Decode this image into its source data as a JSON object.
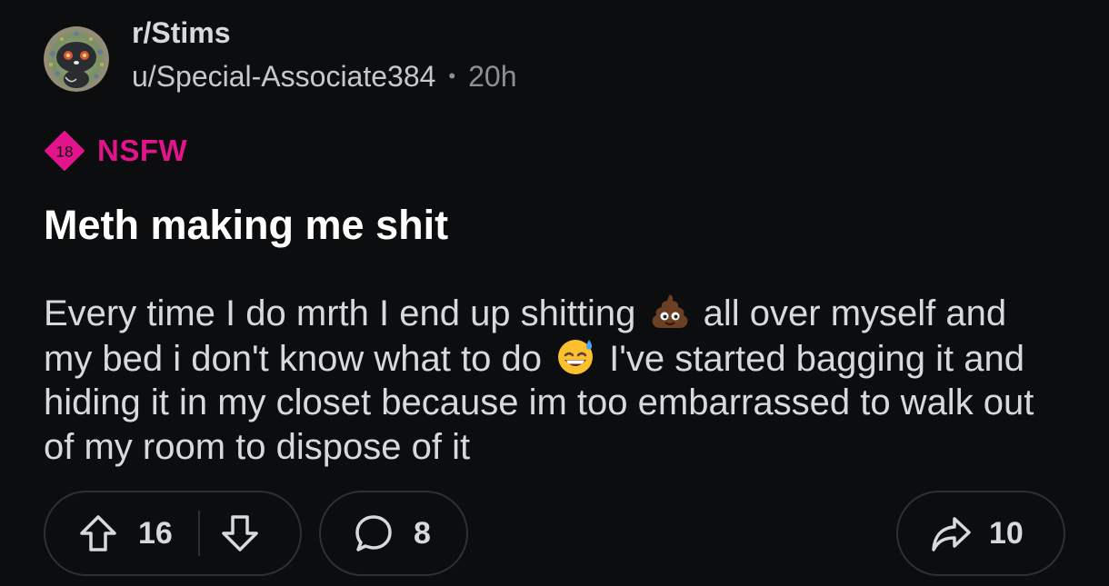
{
  "post": {
    "subreddit": "r/Stims",
    "author": "u/Special-Associate384",
    "separator": "•",
    "age": "20h",
    "nsfw_badge_number": "18",
    "nsfw_label": "NSFW",
    "title": "Meth making me shit",
    "body": {
      "part1": "Every time I do mrth I end up shitting ",
      "emoji1": "poop-emoji",
      "part2": " all over myself and my bed i don't know what to do ",
      "emoji2": "grinning-sweat-emoji",
      "part3": " I've started bagging it and hiding it in my closet because im too embarrassed to walk out of my room to dispose of it"
    }
  },
  "actions": {
    "upvotes": "16",
    "comments": "8",
    "shares": "10"
  },
  "colors": {
    "background": "#0b0d0e",
    "nsfw": "#e3138b",
    "border": "#2b3236",
    "text": "#d7dadc",
    "muted": "#8a9195"
  }
}
